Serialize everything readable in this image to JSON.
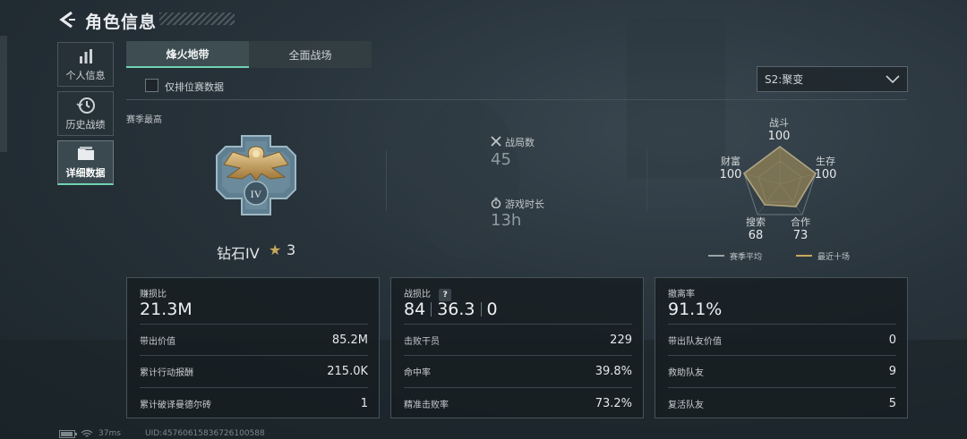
{
  "header": {
    "title": "角色信息"
  },
  "sidebar": {
    "items": [
      {
        "label": "个人信息",
        "icon": "bar-chart-icon"
      },
      {
        "label": "历史战绩",
        "icon": "clock-history-icon"
      },
      {
        "label": "详细数据",
        "icon": "folder-icon"
      }
    ]
  },
  "tabs": [
    {
      "label": "烽火地带"
    },
    {
      "label": "全面战场"
    }
  ],
  "filter": {
    "ranked_only_label": "仅排位赛数据",
    "checked": false
  },
  "season_select": {
    "value": "S2:聚变"
  },
  "season_best": {
    "section_label": "赛季最高",
    "rank_name": "钻石IV",
    "rank_star_icon": "star-icon",
    "rank_stars": "3",
    "emblem_roman": "IV"
  },
  "summary": {
    "matches_label": "战局数",
    "matches_value": "45",
    "playtime_label": "游戏时长",
    "playtime_value": "13h"
  },
  "radar": {
    "axes": [
      {
        "label": "战斗",
        "value": "100"
      },
      {
        "label": "生存",
        "value": "100"
      },
      {
        "label": "合作",
        "value": "73"
      },
      {
        "label": "搜索",
        "value": "68"
      },
      {
        "label": "财富",
        "value": "100"
      }
    ],
    "legend": [
      {
        "label": "赛季平均",
        "color": "#9aa3a7"
      },
      {
        "label": "最近十场",
        "color": "#c9a85b"
      }
    ]
  },
  "cards": {
    "profit": {
      "label": "赚损比",
      "value": "21.3M",
      "rows": [
        {
          "label": "带出价值",
          "value": "85.2M"
        },
        {
          "label": "累计行动报酬",
          "value": "215.0K"
        },
        {
          "label": "累计破译曼德尔砖",
          "value": "1"
        }
      ]
    },
    "combat": {
      "label": "战损比",
      "help_icon": "?",
      "values": [
        "84",
        "36.3",
        "0"
      ],
      "rows": [
        {
          "label": "击败干员",
          "value": "229"
        },
        {
          "label": "命中率",
          "value": "39.8%"
        },
        {
          "label": "精准击败率",
          "value": "73.2%"
        }
      ]
    },
    "extract": {
      "label": "撤离率",
      "value": "91.1%",
      "rows": [
        {
          "label": "带出队友价值",
          "value": "0"
        },
        {
          "label": "救助队友",
          "value": "9"
        },
        {
          "label": "复活队友",
          "value": "5"
        }
      ]
    }
  },
  "footer": {
    "ping": "37ms",
    "uid": "UID:457606158367261005​88"
  },
  "colors": {
    "accent": "#6fd3b3",
    "gold": "#c9a85b"
  }
}
